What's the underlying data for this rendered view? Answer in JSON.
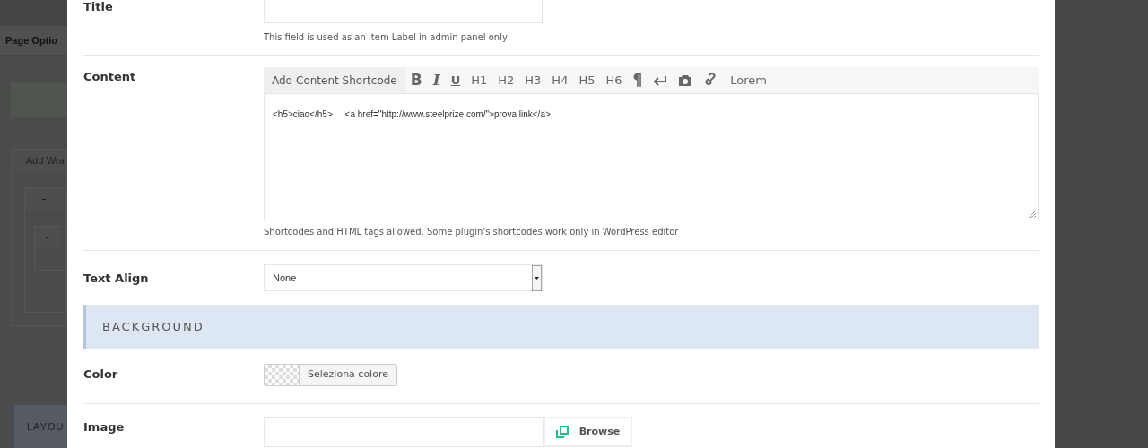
{
  "background_page": {
    "heading": "Page Optio",
    "add_button": "Add Wra",
    "collapse_buttons": [
      "-",
      "-"
    ],
    "section": "LAYOU"
  },
  "modal": {
    "title_field": {
      "label": "Title",
      "help": "This field is used as an Item Label in admin panel only"
    },
    "content_field": {
      "label": "Content",
      "shortcode_tab": "Add Content Shortcode",
      "format_buttons": [
        {
          "text": "B",
          "kind": "bold"
        },
        {
          "text": "I",
          "kind": "italic"
        },
        {
          "text": "U",
          "kind": "underline"
        },
        {
          "text": "H1",
          "kind": "plain"
        },
        {
          "text": "H2",
          "kind": "plain"
        },
        {
          "text": "H3",
          "kind": "plain"
        },
        {
          "text": "H4",
          "kind": "plain"
        },
        {
          "text": "H5",
          "kind": "plain"
        },
        {
          "text": "H6",
          "kind": "plain"
        },
        {
          "text": "¶",
          "kind": "bold"
        }
      ],
      "lorem_button": "Lorem",
      "value": "<h5>ciao</h5>     <a href=\"http://www.steelprize.com/\">prova link</a>",
      "help": "Shortcodes and HTML tags allowed. Some plugin's shortcodes work only in WordPress editor"
    },
    "text_align": {
      "label": "Text Align",
      "value": "None"
    },
    "section": "BACKGROUND",
    "color": {
      "label": "Color",
      "button": "Seleziona colore"
    },
    "image": {
      "label": "Image",
      "button": "Browse"
    }
  }
}
